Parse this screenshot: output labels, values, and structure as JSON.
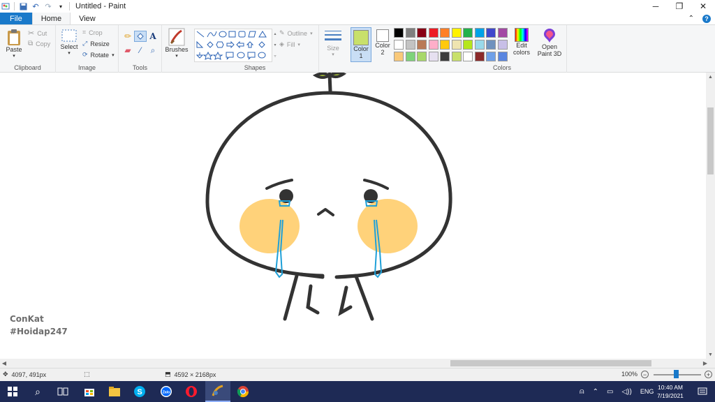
{
  "window": {
    "title": "Untitled - Paint",
    "controls": [
      "─",
      "❐",
      "✕"
    ]
  },
  "tabs": {
    "file": "File",
    "home": "Home",
    "view": "View"
  },
  "ribbon": {
    "clipboard": {
      "label": "Clipboard",
      "paste": "Paste",
      "cut": "Cut",
      "copy": "Copy"
    },
    "image": {
      "label": "Image",
      "select": "Select",
      "crop": "Crop",
      "resize": "Resize",
      "rotate": "Rotate"
    },
    "tools": {
      "label": "Tools"
    },
    "brushes": {
      "label": "Brushes"
    },
    "shapes": {
      "label": "Shapes",
      "outline": "Outline",
      "fill": "Fill"
    },
    "size": {
      "label": "Size"
    },
    "colors": {
      "label": "Colors",
      "color1": "Color 1",
      "color2": "Color 2",
      "edit_colors": "Edit colors",
      "open_paint3d": "Open Paint 3D",
      "color1_value": "#c8e06b",
      "color2_value": "#ffffff",
      "palette_row1": [
        "#000000",
        "#7f7f7f",
        "#880015",
        "#ed1c24",
        "#ff7f27",
        "#fff200",
        "#22b14c",
        "#00a2e8",
        "#3f48cc",
        "#a349a4"
      ],
      "palette_row2": [
        "#ffffff",
        "#c3c3c3",
        "#b97a57",
        "#ffaec9",
        "#ffc90e",
        "#efe4b0",
        "#b5e61d",
        "#99d9ea",
        "#7092be",
        "#c8bfe7"
      ],
      "palette_row3": [
        "#f9c97a",
        "#7ed37a",
        "#a8d86a",
        "#e6e0f0",
        "#3c3c3c",
        "#c8e06b",
        "#ffffff",
        "#8b2a2a",
        "#6fa0e8",
        "#5a86e0"
      ]
    }
  },
  "canvas": {
    "watermark_line1": "ConKat",
    "watermark_line2": "#Hoidap247"
  },
  "statusbar": {
    "cursor_pos": "4097, 491px",
    "image_size": "4592 × 2168px",
    "zoom": "100%"
  },
  "taskbar": {
    "apps": [
      "start",
      "search",
      "task-view",
      "store",
      "file-explorer",
      "skype",
      "zalo",
      "opera",
      "paint",
      "chrome"
    ],
    "language": "ENG",
    "time": "10:40 AM",
    "date": "7/19/2021"
  }
}
